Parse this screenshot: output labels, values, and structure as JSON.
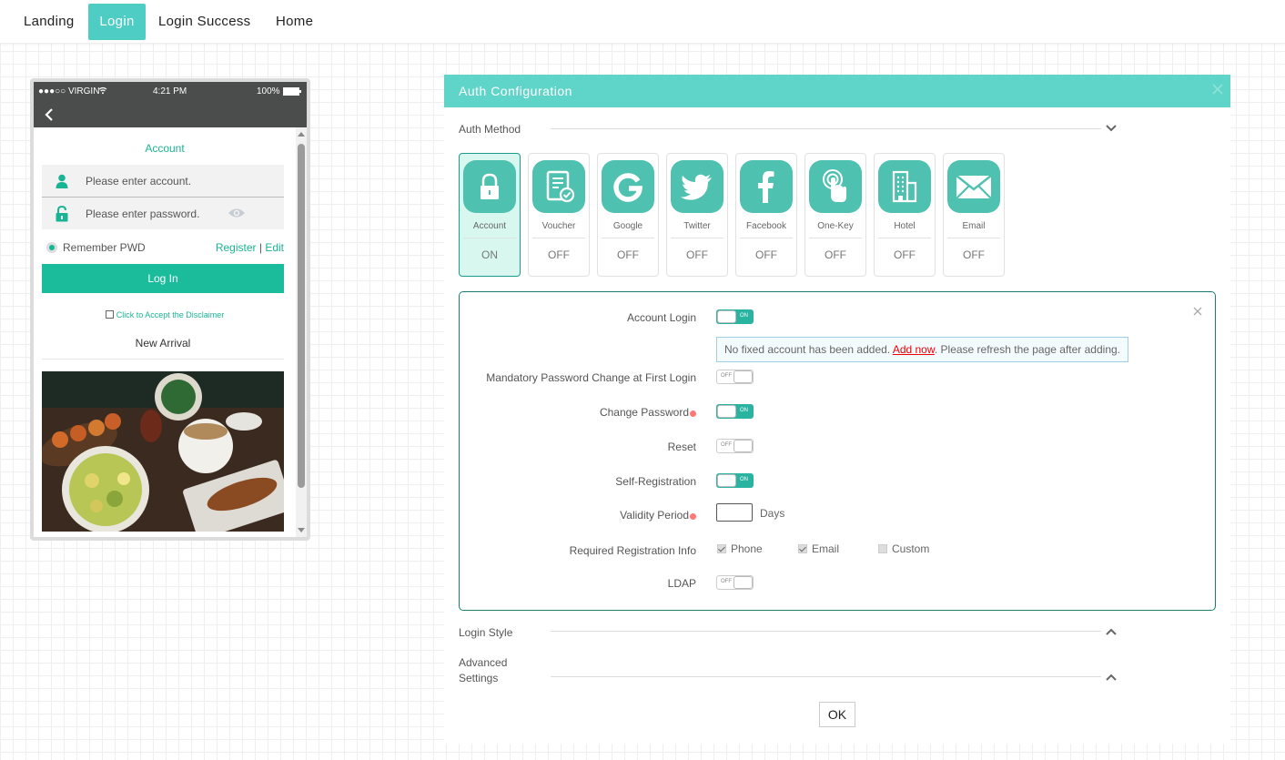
{
  "topnav": {
    "tabs": [
      "Landing",
      "Login",
      "Login Success",
      "Home"
    ],
    "active": "Login"
  },
  "phone": {
    "carrier": "●●●○○ VIRGIN",
    "time": "4:21 PM",
    "battery": "100%",
    "account_title": "Account",
    "account_placeholder": "Please enter account.",
    "password_placeholder": "Please enter password.",
    "remember": "Remember PWD",
    "register": "Register",
    "separator": "|",
    "edit": "Edit",
    "login_button": "Log In",
    "disclaimer": "Click to Accept the Disclaimer",
    "new_arrival": "New Arrival"
  },
  "panel": {
    "title": "Auth Configuration",
    "auth_method_label": "Auth Method",
    "login_style_label": "Login Style",
    "advanced_label_1": "Advanced",
    "advanced_label_2": "Settings",
    "ok": "OK",
    "methods": [
      {
        "name": "Account",
        "state": "ON"
      },
      {
        "name": "Voucher",
        "state": "OFF"
      },
      {
        "name": "Google",
        "state": "OFF"
      },
      {
        "name": "Twitter",
        "state": "OFF"
      },
      {
        "name": "Facebook",
        "state": "OFF"
      },
      {
        "name": "One-Key",
        "state": "OFF"
      },
      {
        "name": "Hotel",
        "state": "OFF"
      },
      {
        "name": "Email",
        "state": "OFF"
      }
    ],
    "details": {
      "account_login": "Account Login",
      "notice_prefix": "No fixed account has been added. ",
      "notice_link": "Add now",
      "notice_suffix": ". Please refresh the page after adding.",
      "mandatory_pw": "Mandatory Password Change at First Login",
      "change_pw": "Change Password",
      "reset": "Reset",
      "self_reg": "Self-Registration",
      "validity": "Validity Period",
      "days": "Days",
      "required_info": "Required Registration Info",
      "phone": "Phone",
      "email": "Email",
      "custom": "Custom",
      "ldap": "LDAP",
      "toggle_on": "ON",
      "toggle_off": "OFF"
    }
  }
}
